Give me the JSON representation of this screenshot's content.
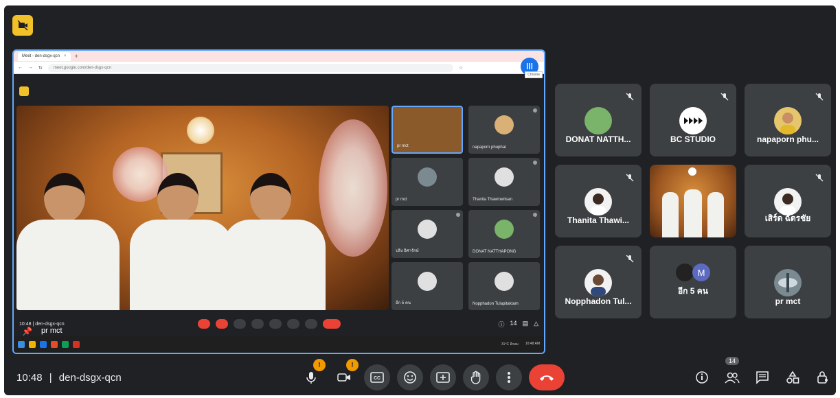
{
  "meeting": {
    "time": "10:48",
    "separator": "|",
    "code": "den-dsgx-qcn"
  },
  "browser": {
    "tab_title": "Meet - den-dsgx-qcn",
    "url": "meet.google.com/den-dsgx-qcn",
    "tooltip": "Chrome"
  },
  "inner_meet": {
    "time_code": "10:48  |  den-dsgx-qcn",
    "pinned_name": "pr mct",
    "count": "14",
    "thumbs": [
      {
        "name": "pr mct"
      },
      {
        "name": "napaporn phuphat"
      },
      {
        "name": "pr mct"
      },
      {
        "name": "Thanita Thawinwitsan"
      },
      {
        "name": "ปลิง อิศารักษ์"
      },
      {
        "name": "DONAT NATTHAPONG"
      },
      {
        "name": "อีก 5 คน"
      },
      {
        "name": "Nopphadon Tulapitaktam"
      }
    ],
    "taskbar_status": {
      "weather": "31°C อีกลม",
      "time": "10:48 AM"
    }
  },
  "participants": [
    {
      "name": "DONAT NATTH...",
      "avatar": "frog"
    },
    {
      "name": "BC STUDIO",
      "avatar": "bc-logo"
    },
    {
      "name": "napaporn phu...",
      "avatar": "person"
    },
    {
      "name": "Thanita Thawi...",
      "avatar": "person"
    },
    {
      "name": "",
      "avatar": "video"
    },
    {
      "name": "เสิร์ด ฉัตรชัย",
      "avatar": "person"
    },
    {
      "name": "Nopphadon Tul...",
      "avatar": "person"
    },
    {
      "name": "อีก 5 คน",
      "avatar": "group",
      "extra_initial": "M"
    },
    {
      "name": "pr mct",
      "avatar": "logo"
    }
  ],
  "controls": {
    "mic_badge": "!",
    "cam_badge": "!",
    "people_count": "14"
  },
  "colors": {
    "background": "#202124",
    "tile": "#3c4043",
    "end_call": "#ea4335",
    "accent": "#64a8ff",
    "badge": "#f29900"
  }
}
